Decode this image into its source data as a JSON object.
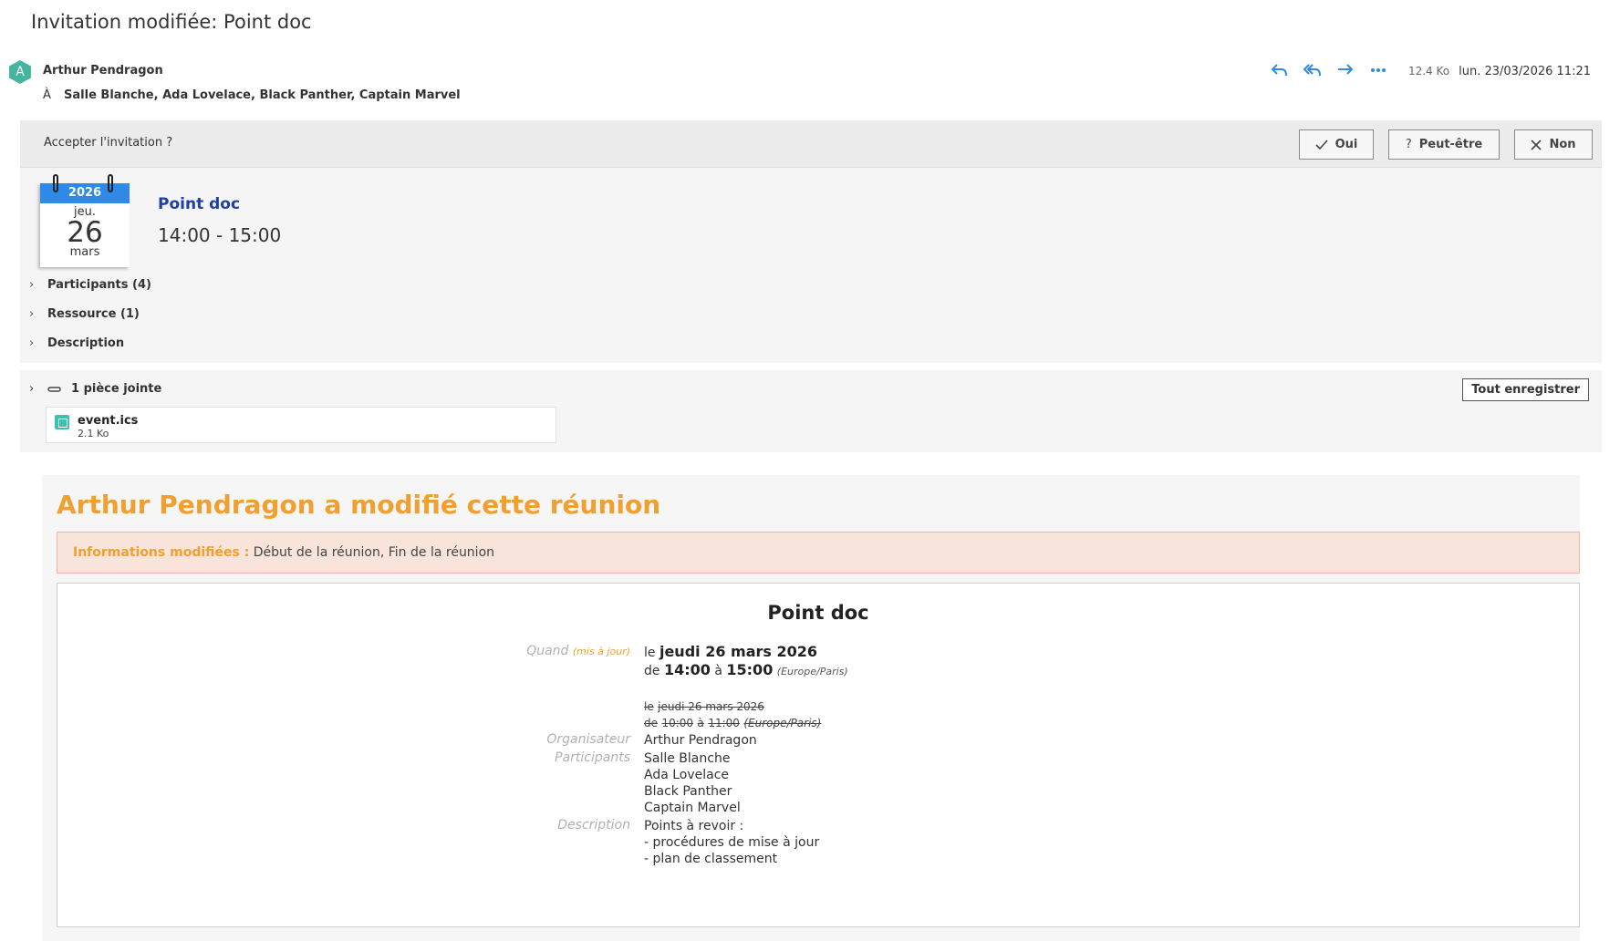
{
  "subject": "Invitation modifiée: Point doc",
  "sender": {
    "initial": "A",
    "name": "Arthur Pendragon"
  },
  "recipients": {
    "prefix": "À",
    "list": "Salle Blanche, Ada Lovelace, Black Panther, Captain Marvel"
  },
  "message": {
    "size": "12.4 Ko",
    "date": "lun. 23/03/2026 11:21"
  },
  "invite": {
    "question": "Accepter l'invitation ?",
    "yes": "Oui",
    "maybe": "Peut-être",
    "no": "Non"
  },
  "calendar": {
    "year": "2026",
    "weekday": "jeu.",
    "day": "26",
    "month": "mars"
  },
  "event": {
    "title": "Point doc",
    "time": "14:00 - 15:00",
    "participants": "Participants (4)",
    "resource": "Ressource (1)",
    "description": "Description"
  },
  "attachments": {
    "heading": "1 pièce jointe",
    "save_all": "Tout enregistrer",
    "file": {
      "name": "event.ics",
      "size": "2.1 Ko"
    }
  },
  "body": {
    "headline": "Arthur Pendragon a modifié cette réunion",
    "changes_label": "Informations modifiées :",
    "changes_text": " Début de la réunion, Fin de la réunion",
    "card_title": "Point doc",
    "when_label": "Quand",
    "updated_tag": "(mis à jour)",
    "new_le": "le",
    "new_date": "jeudi 26 mars 2026",
    "new_de": "de",
    "new_start": "14:00",
    "new_a": "à",
    "new_end": "15:00",
    "timezone": "(Europe/Paris)",
    "old_le": "le",
    "old_date": "jeudi 26 mars 2026",
    "old_de": "de",
    "old_start": "10:00",
    "old_a": "à",
    "old_end": "11:00",
    "old_timezone": "(Europe/Paris)",
    "organizer_label": "Organisateur",
    "organizer": "Arthur Pendragon",
    "participants_label": "Participants",
    "participants": [
      "Salle Blanche",
      "Ada Lovelace",
      "Black Panther",
      "Captain Marvel"
    ],
    "description_label": "Description",
    "description_lines": [
      "Points à revoir :",
      "- procédures de mise à jour",
      "- plan de classement"
    ]
  },
  "colors": {
    "accent_blue": "#2e8ae6",
    "orange": "#f0a030",
    "avatar": "#46b4a0",
    "event_title": "#1f3fa8"
  }
}
